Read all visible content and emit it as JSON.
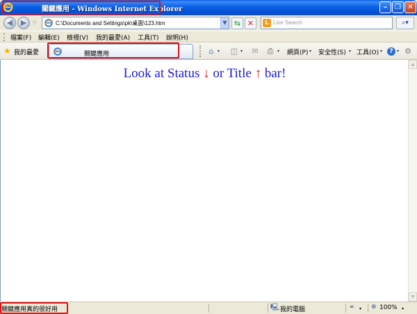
{
  "window": {
    "title": "關鍵應用 - Windows Internet Explorer",
    "minimize_glyph": "–",
    "restore_glyph": "❐",
    "close_glyph": "✕"
  },
  "toolbar": {
    "back_glyph": "◀",
    "forward_glyph": "▶",
    "recent_glyph": "▽",
    "address": "C:\\Documents and Settings\\pk\\桌面\\123.htm",
    "address_drop_glyph": "▼",
    "refresh_glyph": "⇆",
    "stop_glyph": "✕",
    "search_provider_glyph": "L",
    "search_placeholder": "Live Search",
    "search_go_glyph": "⌕▾"
  },
  "menu": {
    "items": [
      "檔案(F)",
      "編輯(E)",
      "檢視(V)",
      "我的最愛(A)",
      "工具(T)",
      "說明(H)"
    ]
  },
  "favorites": {
    "label": "我的最愛",
    "star_glyph": "★"
  },
  "tab": {
    "label": "關鍵應用"
  },
  "command_bar": {
    "home_glyph": "⌂",
    "feeds_glyph": "◫",
    "mail_glyph": "✉",
    "print_glyph": "⎙",
    "drop_glyph": "▾",
    "page_label": "網頁(P)",
    "safety_label": "安全性(S)",
    "tools_label": "工具(O)",
    "help_glyph": "?",
    "research_glyph": "⚙"
  },
  "content": {
    "heading_part1": "Look at Status",
    "down_arrow": "↓",
    "heading_part2": "or Title",
    "up_arrow": "↑",
    "heading_part3": "bar!"
  },
  "scrollbar": {
    "up_glyph": "▲",
    "down_glyph": "▼"
  },
  "statusbar": {
    "text": "關鍵應用真的很好用",
    "zone_glyph": "🖳",
    "zone": "我的電腦",
    "protected_glyph": "⚭",
    "zoom_glyph": "⊕",
    "zoom": "100%",
    "drop_glyph": "▾"
  },
  "colors": {
    "highlight": "#e01010",
    "heading_text": "#1a1ad8",
    "arrow": "#e01010"
  }
}
